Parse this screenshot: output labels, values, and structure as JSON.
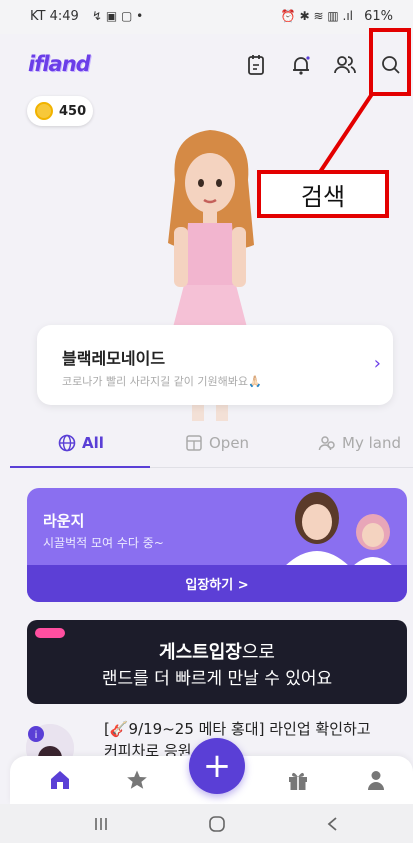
{
  "status_bar": {
    "carrier_time": "KT 4:49",
    "battery": "61%"
  },
  "header": {
    "logo_text": "ifland"
  },
  "coins": {
    "amount": "450"
  },
  "annotation": {
    "label": "검색"
  },
  "profile": {
    "name": "블랙레모네이드",
    "status": "코로나가 빨리 사라지길 같이 기원해봐요🙏🏻"
  },
  "tabs": [
    {
      "label": "All"
    },
    {
      "label": "Open"
    },
    {
      "label": "My land"
    }
  ],
  "lounge": {
    "title": "라운지",
    "subtitle": "시끌벅적 모여 수다 중~",
    "enter_label": "입장하기 >"
  },
  "guest_banner": {
    "line1_bold": "게스트입장",
    "line1_rest": "으로",
    "line2": "랜드를 더 빠르게 만날 수 있어요"
  },
  "news": {
    "line1": "[🎸9/19~25 메타 홍대] 라인업 확인하고",
    "line2": "커피차로 응원"
  },
  "colors": {
    "accent": "#5a3fd6",
    "annotation": "#e30000"
  }
}
